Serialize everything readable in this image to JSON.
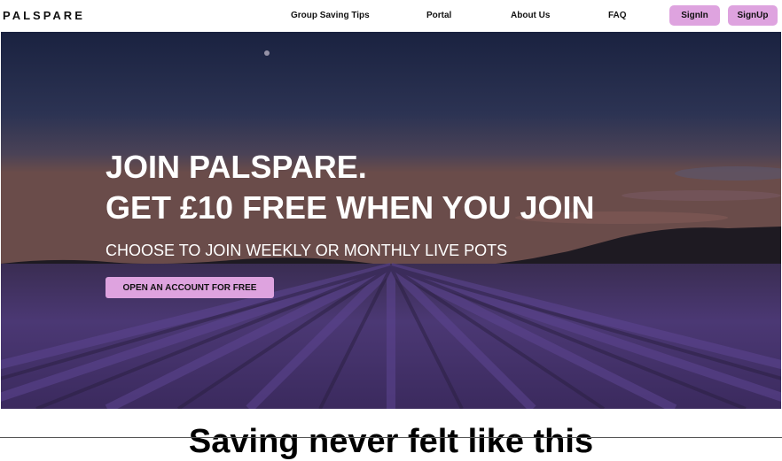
{
  "nav": {
    "logo": "PALSPARE",
    "links": [
      "Group Saving Tips",
      "Portal",
      "About Us",
      "FAQ"
    ],
    "signin_label": "SignIn",
    "signup_label": "SignUp"
  },
  "hero": {
    "title_line1": "JOIN PALSPARE.",
    "title_line2": "GET £10 FREE WHEN YOU JOIN",
    "subtitle": "CHOOSE TO JOIN WEEKLY OR MONTHLY LIVE POTS",
    "cta_label": "OPEN AN ACCOUNT FOR FREE"
  },
  "section": {
    "heading": "Saving never felt like this"
  },
  "colors": {
    "accent": "#dea3df",
    "text": "#111111",
    "hero_text": "#ffffff"
  }
}
